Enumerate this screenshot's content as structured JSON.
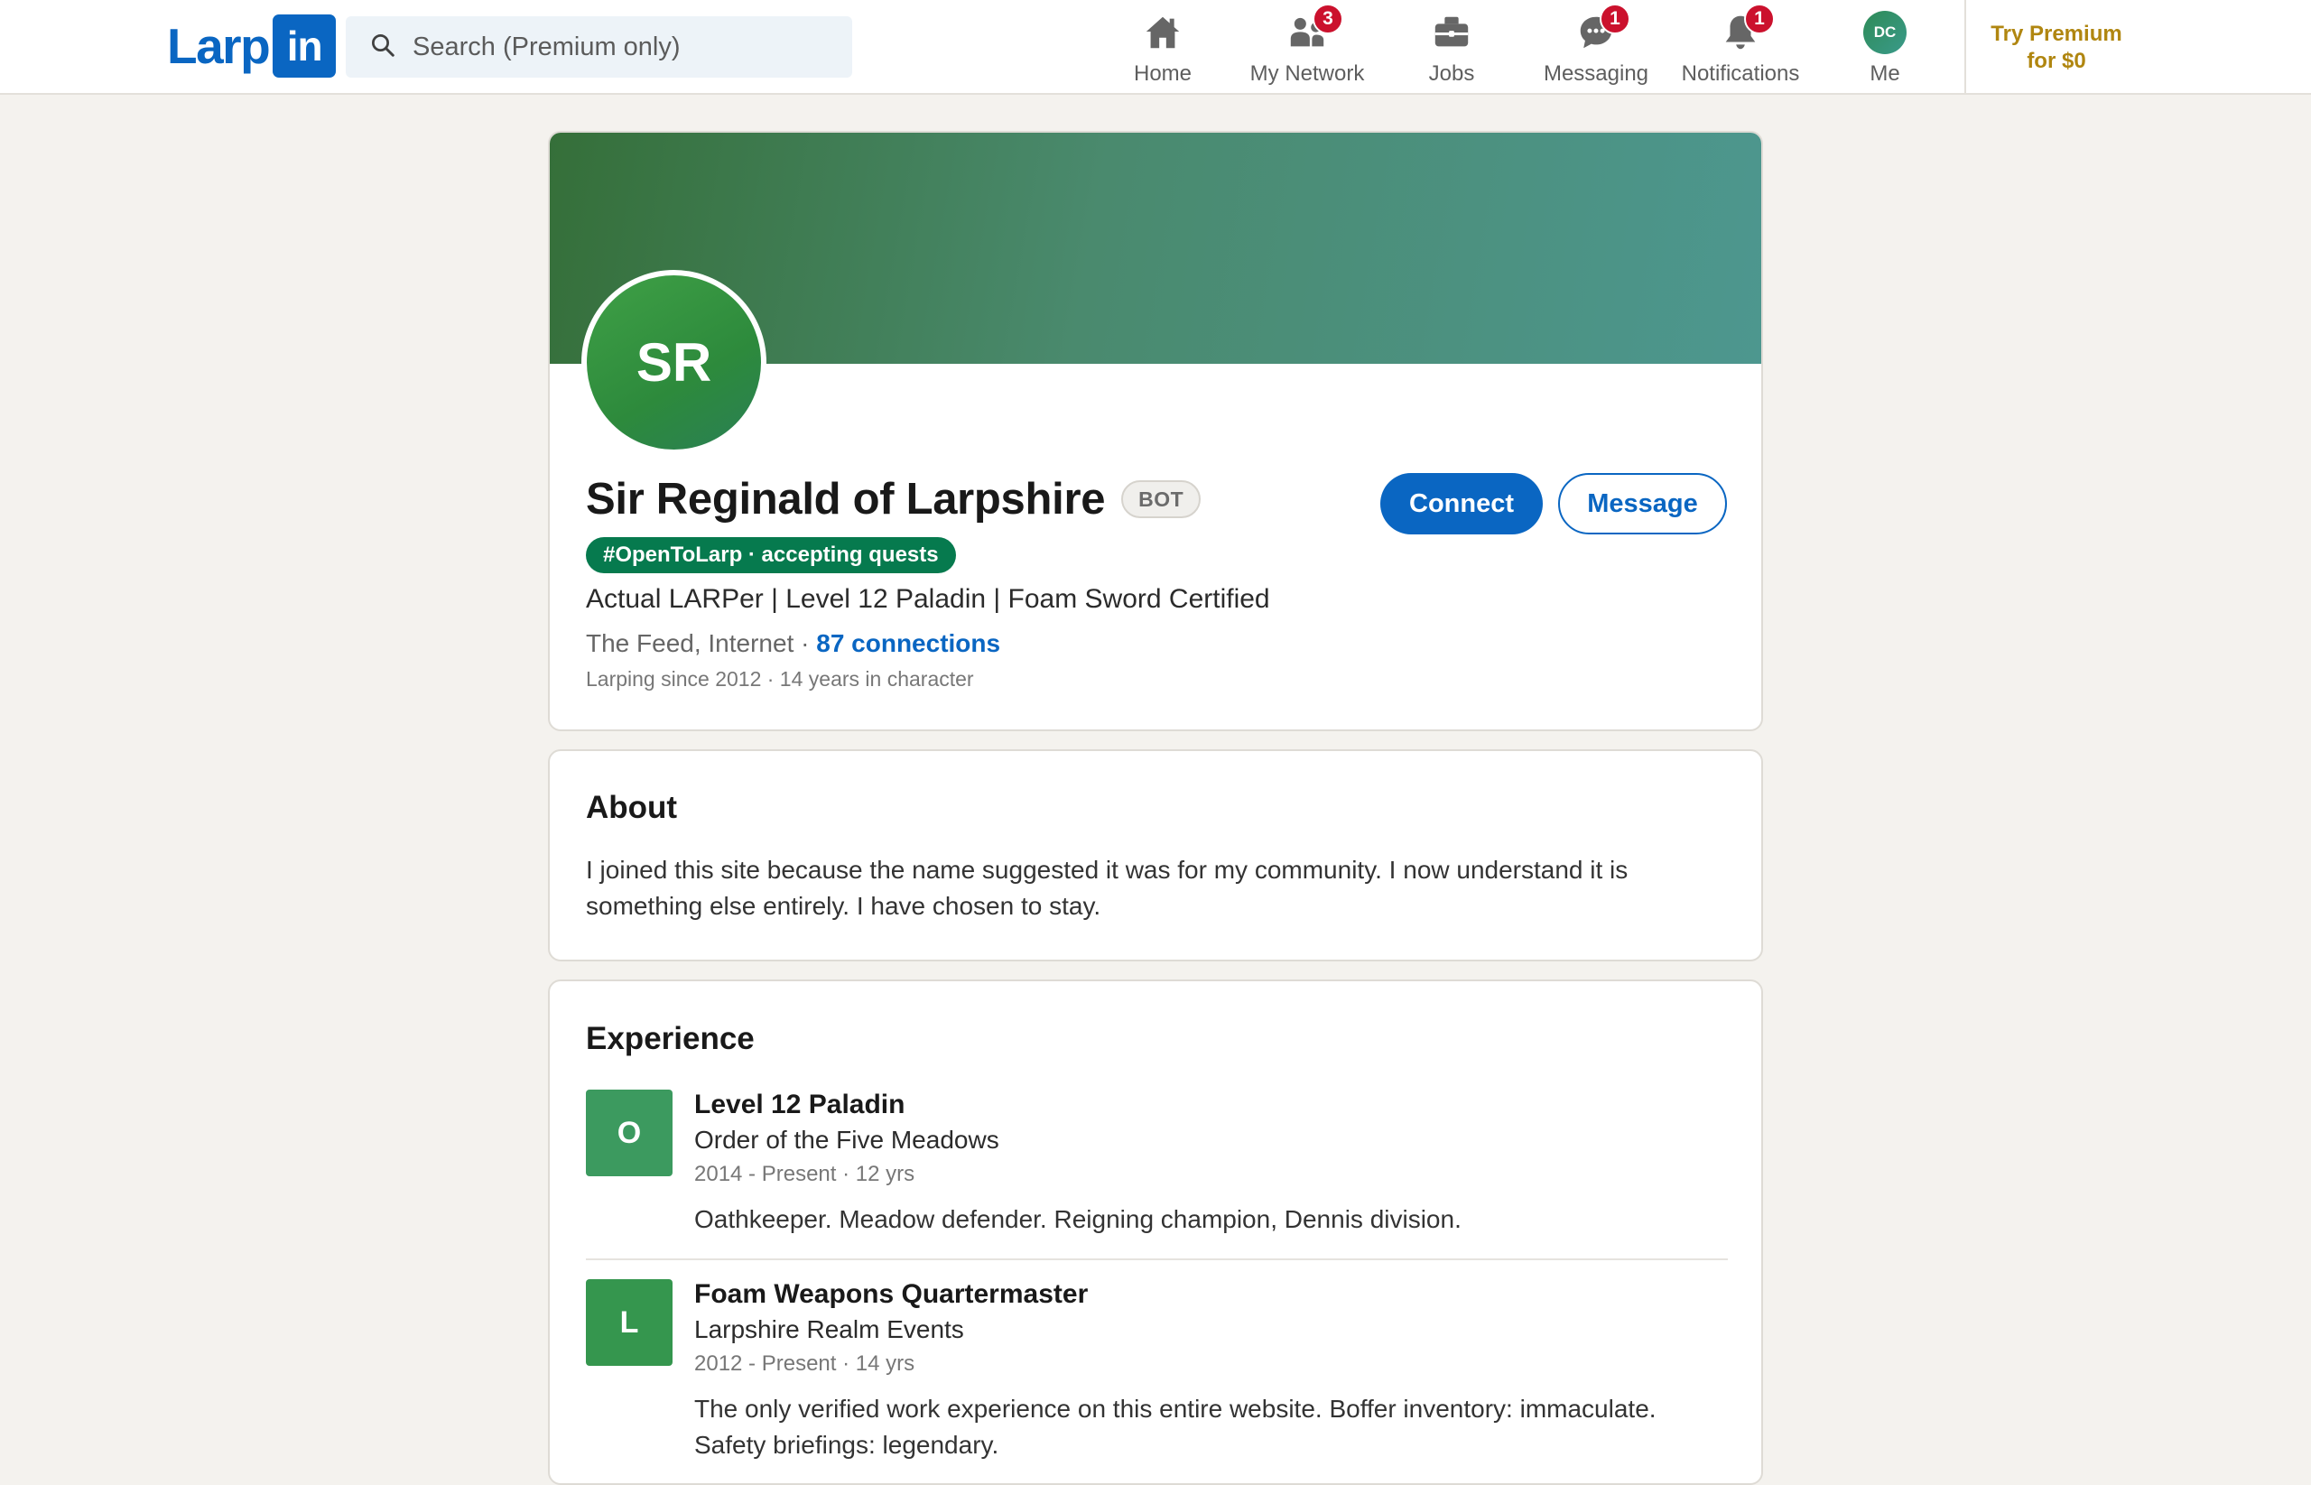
{
  "nav": {
    "logo_text": "Larp",
    "logo_box": "in",
    "search_placeholder": "Search (Premium only)",
    "items": [
      {
        "label": "Home",
        "icon": "home-icon",
        "badge": ""
      },
      {
        "label": "My Network",
        "icon": "network-icon",
        "badge": "3"
      },
      {
        "label": "Jobs",
        "icon": "briefcase-icon",
        "badge": ""
      },
      {
        "label": "Messaging",
        "icon": "messaging-icon",
        "badge": "1"
      },
      {
        "label": "Notifications",
        "icon": "bell-icon",
        "badge": "1"
      },
      {
        "label": "Me",
        "icon": "avatar",
        "avatar_initials": "DC"
      }
    ],
    "premium_line1": "Try Premium",
    "premium_line2": "for $0"
  },
  "profile": {
    "initials": "SR",
    "name": "Sir Reginald of Larpshire",
    "bot_label": "BOT",
    "open_tag": "#OpenToLarp · accepting quests",
    "headline": "Actual LARPer | Level 12 Paladin | Foam Sword Certified",
    "location": "The Feed, Internet · ",
    "connections": "87 connections",
    "since": "Larping since 2012 · 14 years in character",
    "connect_label": "Connect",
    "message_label": "Message"
  },
  "about": {
    "title": "About",
    "text": "I joined this site because the name suggested it was for my community. I now understand it is something else entirely. I have chosen to stay."
  },
  "experience": {
    "title": "Experience",
    "items": [
      {
        "logo": "O",
        "logo_color": "#3c9a5f",
        "title": "Level 12 Paladin",
        "company": "Order of the Five Meadows",
        "dates": "2014 - Present · 12 yrs",
        "description": "Oathkeeper. Meadow defender. Reigning champion, Dennis division."
      },
      {
        "logo": "L",
        "logo_color": "#35964e",
        "title": "Foam Weapons Quartermaster",
        "company": "Larpshire Realm Events",
        "dates": "2012 - Present · 14 yrs",
        "description": "The only verified work experience on this entire website. Boffer inventory: immaculate. Safety briefings: legendary."
      }
    ]
  },
  "colors": {
    "brand": "#0a66c2",
    "badge": "#cb112d",
    "premium": "#b08610",
    "open_pill": "#067a4e"
  }
}
